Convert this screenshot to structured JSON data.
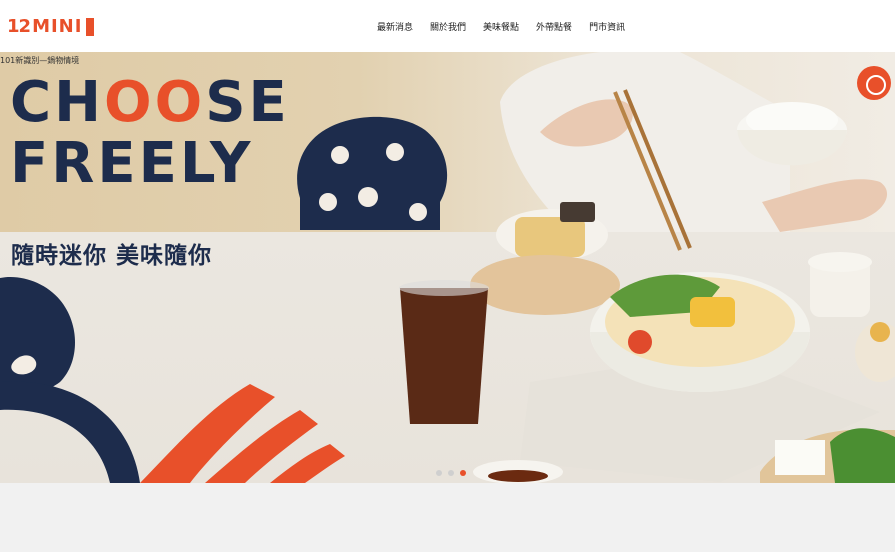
{
  "header": {
    "logo": {
      "number": "12",
      "word": "MINI",
      "badge_text": ""
    },
    "nav": [
      {
        "label": "最新消息"
      },
      {
        "label": "關於我們"
      },
      {
        "label": "美味餐點"
      },
      {
        "label": "外帶點餐"
      },
      {
        "label": "門市資訊"
      }
    ]
  },
  "hero": {
    "caption": "101新識別—鍋物情境",
    "headline": {
      "line1_pre": "CH",
      "line1_oo": "OO",
      "line1_post": "SE",
      "line2": "FREELY"
    },
    "tagline": "隨時迷你 美味隨你",
    "slides": {
      "count": 3,
      "active": 3
    }
  },
  "colors": {
    "accent": "#e8502a",
    "navy": "#1d2c4c"
  },
  "icons": [
    "logo-badge-icon",
    "floating-circle-icon"
  ]
}
